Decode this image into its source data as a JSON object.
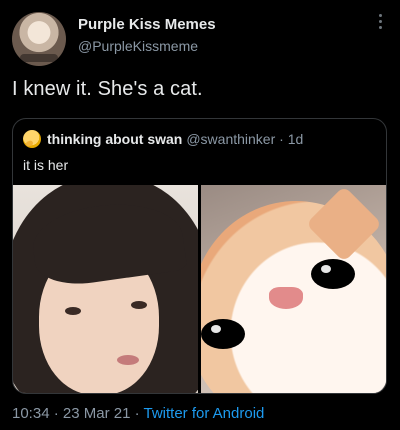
{
  "tweet": {
    "display_name": "Purple Kiss Memes",
    "handle": "@PurpleKissmeme",
    "text": "I knew it. She's a cat."
  },
  "quote": {
    "display_name": "thinking about swan",
    "meta": "@swanthinker · 1d",
    "text": "it is her"
  },
  "footer": {
    "time": "10:34",
    "date_prefix": " · 23 Mar 21 · ",
    "source": "Twitter for Android"
  },
  "colors": {
    "background": "#000000",
    "text_primary": "#e7e9ea",
    "text_secondary": "#8b98a5",
    "link": "#1d9bf0",
    "border": "#333639"
  },
  "icons": {
    "more": "more-vertical-icon",
    "emoji": "thinking-face-icon"
  }
}
